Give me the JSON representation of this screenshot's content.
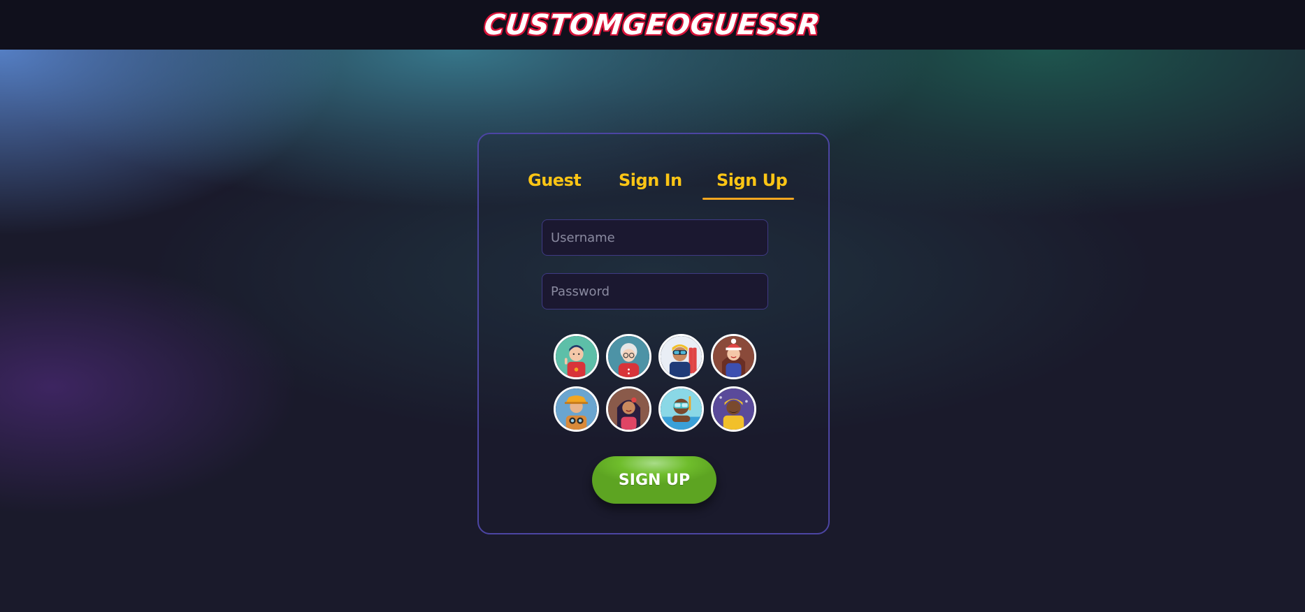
{
  "header": {
    "logo_text": "CUSTOMGEOGUESSR"
  },
  "tabs": [
    {
      "label": "Guest"
    },
    {
      "label": "Sign In"
    },
    {
      "label": "Sign Up",
      "active": true
    }
  ],
  "form": {
    "username_placeholder": "Username",
    "password_placeholder": "Password",
    "submit_label": "SIGN UP"
  },
  "avatars": [
    {
      "name": "peace-sign-man-avatar",
      "bg": "#5dbfa8"
    },
    {
      "name": "grandma-avatar",
      "bg": "#4d93a6"
    },
    {
      "name": "skier-avatar",
      "bg": "#e9eef5"
    },
    {
      "name": "winter-woman-avatar",
      "bg": "#8a4a3a"
    },
    {
      "name": "safari-explorer-avatar",
      "bg": "#6aa5d0"
    },
    {
      "name": "flower-woman-avatar",
      "bg": "#8a5a4a"
    },
    {
      "name": "snorkeler-avatar",
      "bg": "#8ad8e6"
    },
    {
      "name": "raincoat-man-avatar",
      "bg": "#5a4a9a"
    }
  ],
  "colors": {
    "accent": "#fbc515",
    "tab_underline": "#f2a620",
    "card_border": "#4c45a3",
    "button_green": "#6fbd2c",
    "logo_outline": "#d8143a"
  }
}
